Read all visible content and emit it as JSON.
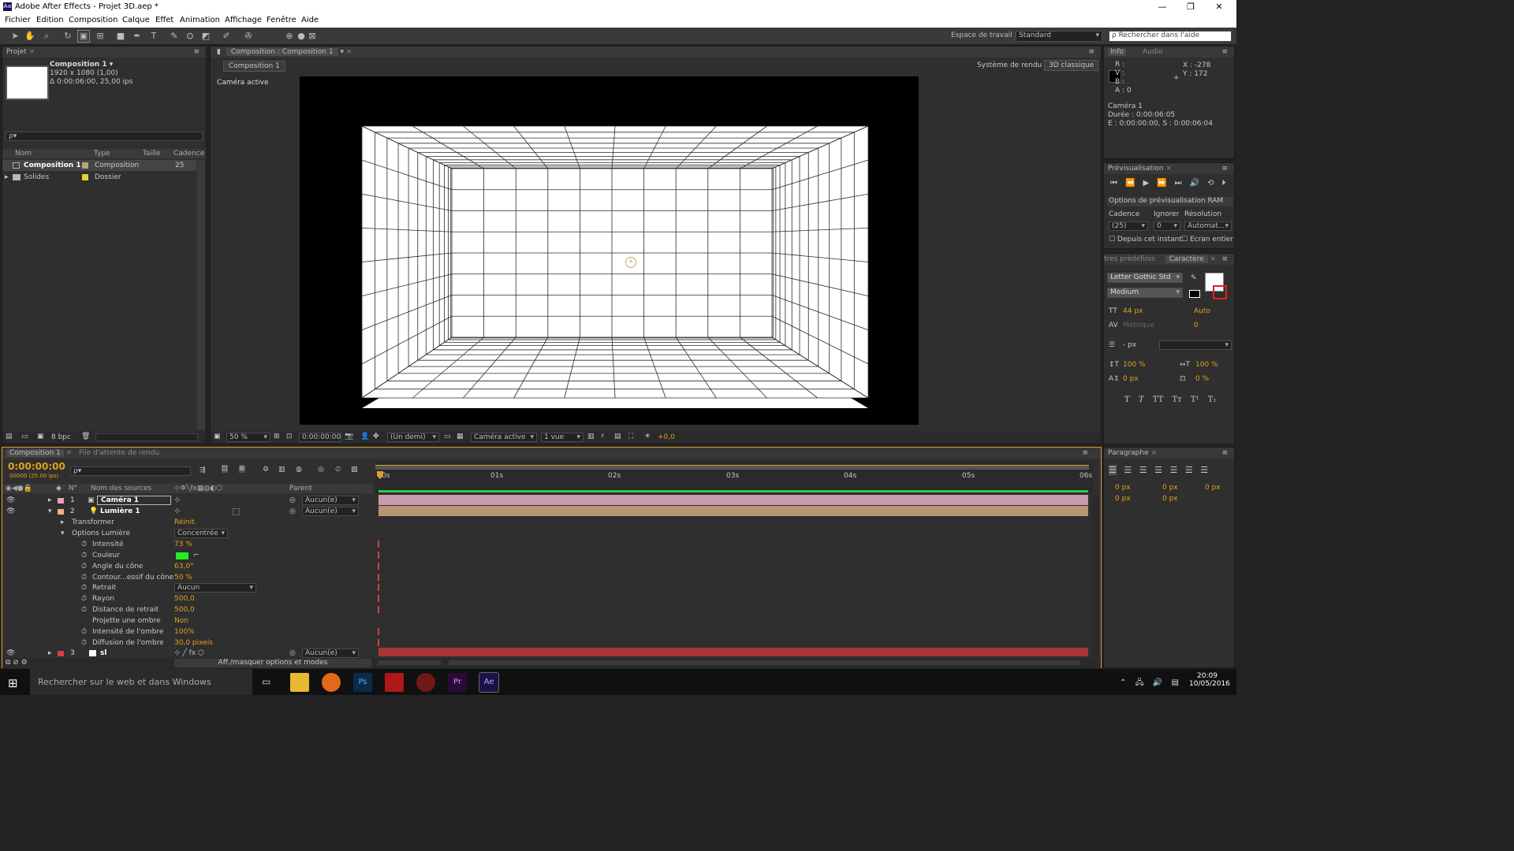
{
  "title": "Adobe After Effects - Projet 3D.aep *",
  "menu": [
    "Fichier",
    "Edition",
    "Composition",
    "Calque",
    "Effet",
    "Animation",
    "Affichage",
    "Fenêtre",
    "Aide"
  ],
  "workspace": {
    "label": "Espace de travail :",
    "value": "Standard",
    "search": "Rechercher dans l'aide"
  },
  "project": {
    "tab": "Projet",
    "comp_name": "Composition 1 ▾",
    "comp_size": "1920 x 1080 (1,00)",
    "comp_duration": "Δ 0:00:06:00, 25,00 ips",
    "search_placeholder": "ρ▾",
    "columns": [
      "Nom",
      "Type",
      "Taille",
      "Cadence"
    ],
    "items": [
      {
        "name": "Composition 1",
        "type": "Composition",
        "rate": "25",
        "color": "#b4a878"
      },
      {
        "name": "Solides",
        "type": "Dossier",
        "rate": "",
        "color": "#e8d02a"
      }
    ],
    "bpc": "8 bpc"
  },
  "viewer": {
    "tab": "Composition : Composition 1",
    "subtab": "Composition 1",
    "renderer_label": "Système de rendu :",
    "renderer": "3D classique",
    "active_camera": "Caméra active",
    "zoom": "50 %",
    "timecode": "0:00:00:00",
    "resolution": "(Un demi)",
    "camera": "Caméra active",
    "views": "1 vue",
    "exposure": "+0,0"
  },
  "info": {
    "tab": "Info",
    "tab2": "Audio",
    "r": "R :",
    "g": "V :",
    "b": "B :",
    "a": "A : 0",
    "x": "X : -278",
    "y": "Y : 172",
    "layer": "Caméra 1",
    "duration": "Durée : 0:00:06:05",
    "in_out": "E : 0:00:00:00, S : 0:00:06:04"
  },
  "preview": {
    "tab": "Prévisualisation",
    "ram": "Options de prévisualisation RAM",
    "labels": [
      "Cadence",
      "Ignorer",
      "Résolution"
    ],
    "values": [
      "(25)",
      "0",
      "Automat..."
    ],
    "checks": [
      "Depuis cet instant",
      "Ecran entier"
    ]
  },
  "character": {
    "tab_presets": "tres prédéfinis",
    "tab": "Caractère",
    "font": "Letter Gothic Std",
    "style": "Medium",
    "size": "44 px",
    "leading": "Auto",
    "kerning": "Métrique",
    "tracking": "0",
    "stroke": "- px",
    "vscale": "100 %",
    "hscale": "100 %",
    "baseline": "0 px",
    "tsume": "0 %",
    "styles": [
      "T",
      "T",
      "TT",
      "Tт",
      "T¹",
      "T₁"
    ]
  },
  "paragraph": {
    "tab": "Paragraphe",
    "indents": [
      "0 px",
      "0 px",
      "0 px",
      "0 px",
      "0 px"
    ]
  },
  "timeline": {
    "tab": "Composition 1",
    "tab2": "File d'attente de rendu",
    "time": "0:00:00:00",
    "frames": "00000 (25.00 ips)",
    "col_num": "N°",
    "col_source": "Nom des sources",
    "col_parent": "Parent",
    "ruler": [
      "0s",
      "01s",
      "02s",
      "03s",
      "04s",
      "05s",
      "06s"
    ],
    "layers": [
      {
        "num": "1",
        "name": "Caméra 1",
        "color": "#e8a0b8",
        "parent": "Aucun(e)",
        "bar": "#b48aa0"
      },
      {
        "num": "2",
        "name": "Lumière 1",
        "color": "#e8b48a",
        "parent": "Aucun(e)",
        "bar": "#b4967a"
      },
      {
        "num": "3",
        "name": "sl",
        "color": "#d84040",
        "parent": "Aucun(e)",
        "bar": "#a03030"
      }
    ],
    "props": [
      {
        "name": "Transformer",
        "value": "Réinit.",
        "indent": 1,
        "key": false
      },
      {
        "name": "Options Lumière",
        "value": "Concentrée",
        "indent": 1,
        "key": false
      },
      {
        "name": "Intensité",
        "value": "73 %",
        "indent": 2,
        "key": true
      },
      {
        "name": "Couleur",
        "value": "",
        "indent": 2,
        "key": true
      },
      {
        "name": "Angle du cône",
        "value": "63,0°",
        "indent": 2,
        "key": true
      },
      {
        "name": "Contour...essif du cône",
        "value": "50 %",
        "indent": 2,
        "key": true
      },
      {
        "name": "Retrait",
        "value": "Aucun",
        "indent": 2,
        "key": true
      },
      {
        "name": "Rayon",
        "value": "500,0",
        "indent": 2,
        "key": true
      },
      {
        "name": "Distance de retrait",
        "value": "500,0",
        "indent": 2,
        "key": true
      },
      {
        "name": "Projette une ombre",
        "value": "Non",
        "indent": 2,
        "key": false
      },
      {
        "name": "Intensité de l'ombre",
        "value": "100%",
        "indent": 2,
        "key": true
      },
      {
        "name": "Diffusion de l'ombre",
        "value": "30,0 pixels",
        "indent": 2,
        "key": true
      }
    ],
    "toggle_label": "Aff./masquer options et modes"
  },
  "taskbar": {
    "search": "Rechercher sur le web et dans Windows",
    "time": "20:09",
    "date": "10/05/2016",
    "apps": [
      "Ps",
      "Pr",
      "Ae"
    ]
  },
  "colors": {
    "accent": "#e3a020",
    "light_color": "#22ee22"
  }
}
